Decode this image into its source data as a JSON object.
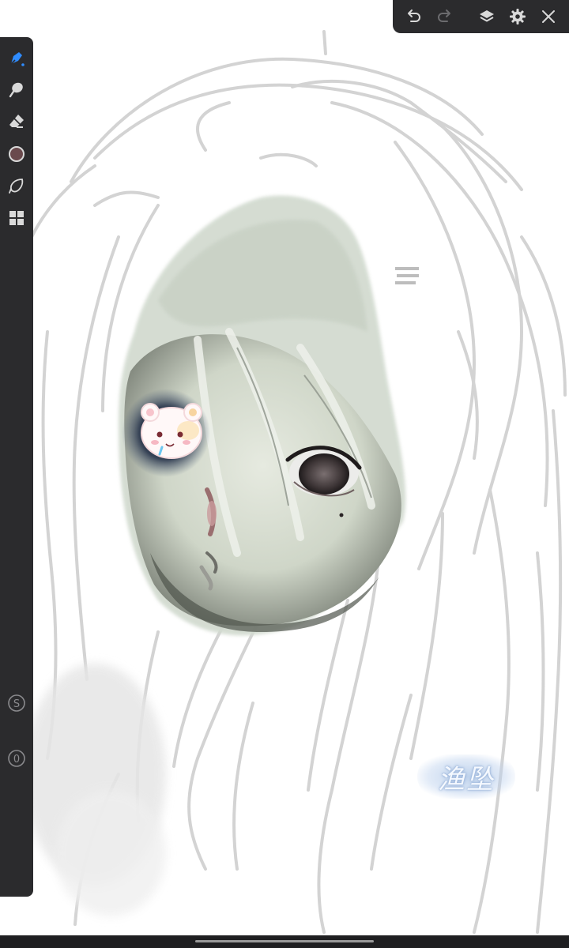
{
  "top_toolbar": {
    "actions": [
      "undo-icon",
      "redo-icon",
      "layers-icon",
      "settings-icon",
      "close-icon"
    ]
  },
  "left_toolbar": {
    "tools": [
      "brush-icon",
      "smudge-icon",
      "eraser-icon",
      "color-swatch",
      "lasso-icon",
      "gallery-grid-icon"
    ],
    "active_tool": "brush",
    "current_color": "#6a4a4d",
    "size_label": "S",
    "opacity_label": "0"
  },
  "artwork": {
    "signature_text": "渔坠"
  },
  "colors": {
    "toolbar_bg": "#2b2b2d",
    "accent": "#2f8cff",
    "icon": "#d9d9d9"
  }
}
